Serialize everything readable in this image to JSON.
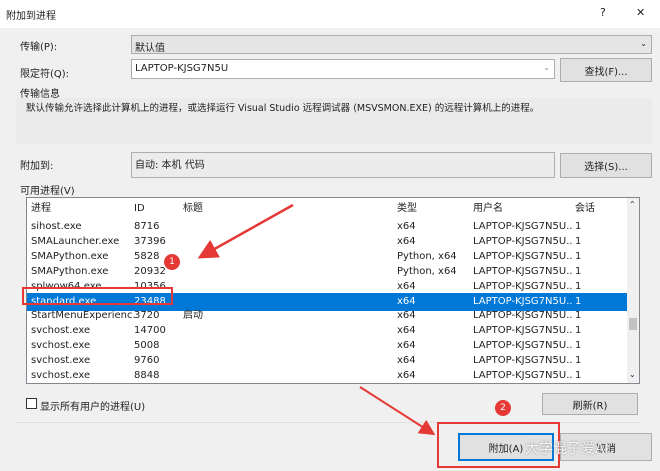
{
  "title": "附加到进程",
  "help": "?",
  "close": "✕",
  "transport": {
    "label": "传输(P):",
    "value": "默认值"
  },
  "qualifier": {
    "label": "限定符(Q):",
    "value": "LAPTOP-KJSG7N5U",
    "find": "查找(F)..."
  },
  "info": {
    "label": "传输信息",
    "text": "默认传输允许选择此计算机上的进程，或选择运行 Visual Studio 远程调试器 (MSVSMON.EXE) 的远程计算机上的进程。"
  },
  "attach_to": {
    "label": "附加到:",
    "value": "自动: 本机 代码",
    "select": "选择(S)..."
  },
  "processes": {
    "label": "可用进程(V)",
    "columns": [
      "进程",
      "ID",
      "标题",
      "类型",
      "用户名",
      "会话"
    ],
    "rows": [
      [
        "sihost.exe",
        "8716",
        "",
        "x64",
        "LAPTOP-KJSG7N5U...",
        "1"
      ],
      [
        "SMALauncher.exe",
        "37396",
        "",
        "x64",
        "LAPTOP-KJSG7N5U...",
        "1"
      ],
      [
        "SMAPython.exe",
        "5828",
        "",
        "Python, x64",
        "LAPTOP-KJSG7N5U...",
        "1"
      ],
      [
        "SMAPython.exe",
        "20932",
        "",
        "Python, x64",
        "LAPTOP-KJSG7N5U...",
        "1"
      ],
      [
        "splwow64.exe",
        "10356",
        "",
        "x64",
        "LAPTOP-KJSG7N5U...",
        "1"
      ],
      [
        "standard.exe",
        "23488",
        "",
        "x64",
        "LAPTOP-KJSG7N5U...",
        "1"
      ],
      [
        "StartMenuExperienc...",
        "3720",
        "启动",
        "x64",
        "LAPTOP-KJSG7N5U...",
        "1"
      ],
      [
        "svchost.exe",
        "14700",
        "",
        "x64",
        "LAPTOP-KJSG7N5U...",
        "1"
      ],
      [
        "svchost.exe",
        "5008",
        "",
        "x64",
        "LAPTOP-KJSG7N5U...",
        "1"
      ],
      [
        "svchost.exe",
        "9760",
        "",
        "x64",
        "LAPTOP-KJSG7N5U...",
        "1"
      ],
      [
        "svchost.exe",
        "8848",
        "",
        "x64",
        "LAPTOP-KJSG7N5U...",
        "1"
      ]
    ],
    "selected_index": 5
  },
  "show_all": {
    "label": "显示所有用户的进程(U)",
    "checked": false
  },
  "refresh": "刷新(R)",
  "attach": "附加(A)",
  "cancel": "取消",
  "annotations": [
    "1",
    "2"
  ],
  "watermark": "大学混子爱AI",
  "colors": {
    "accent": "#0078d7",
    "annotation": "#e53935"
  }
}
